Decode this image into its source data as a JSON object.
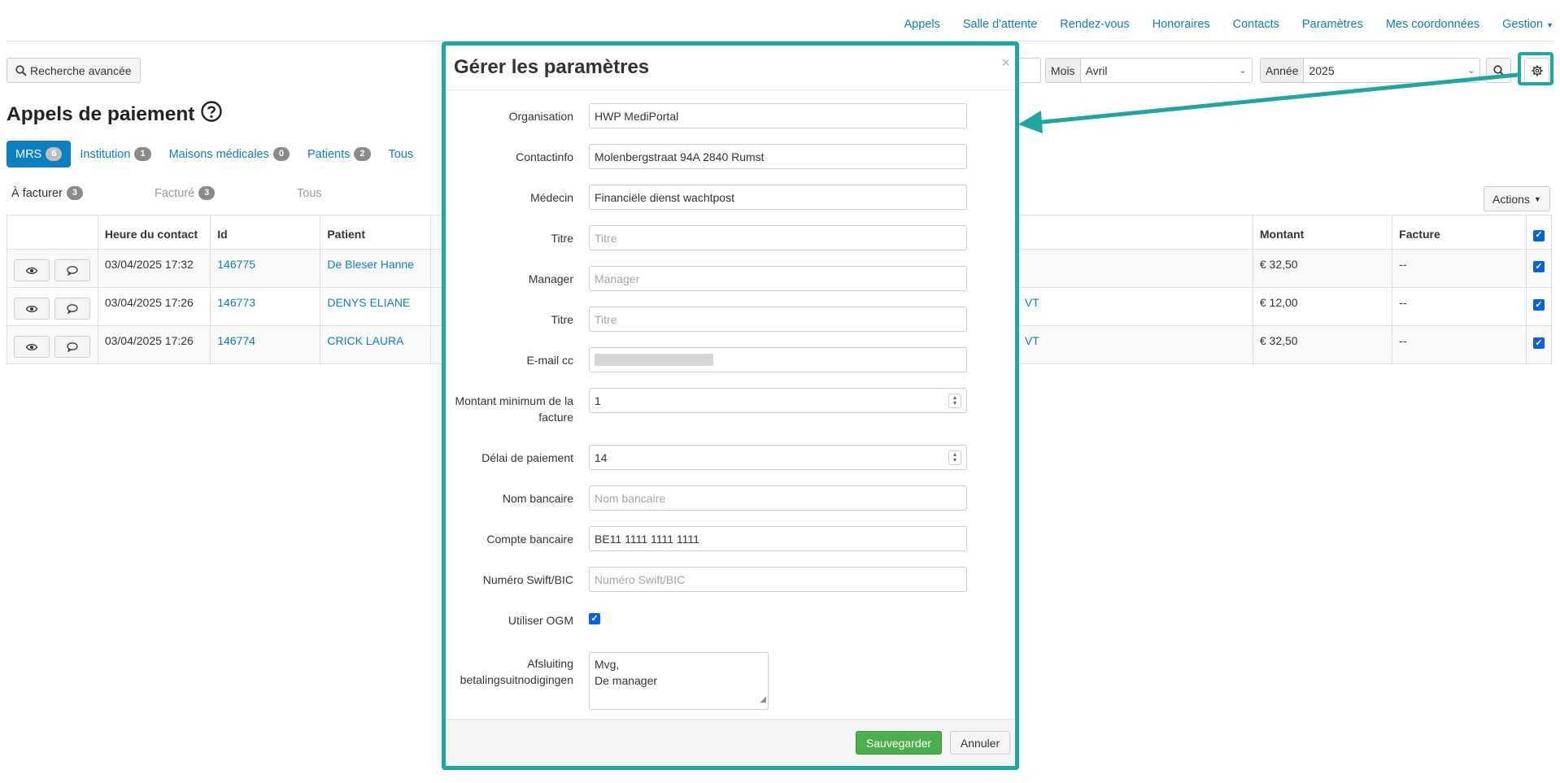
{
  "nav": {
    "items": [
      "Appels",
      "Salle d'attente",
      "Rendez-vous",
      "Honoraires",
      "Contacts",
      "Paramètres",
      "Mes coordonnées"
    ],
    "gestion": "Gestion"
  },
  "toolbar": {
    "advanced_search": "Recherche avancée",
    "month_label": "Mois",
    "month_value": "Avril",
    "year_label": "Année",
    "year_value": "2025"
  },
  "page": {
    "title": "Appels de paiement"
  },
  "tabs": [
    {
      "label": "MRS",
      "count": "6"
    },
    {
      "label": "Institution",
      "count": "1"
    },
    {
      "label": "Maisons médicales",
      "count": "0"
    },
    {
      "label": "Patients",
      "count": "2"
    },
    {
      "label": "Tous"
    }
  ],
  "subtabs": [
    {
      "label": "À facturer",
      "count": "3"
    },
    {
      "label": "Facturé",
      "count": "3"
    },
    {
      "label": "Tous"
    }
  ],
  "actions_label": "Actions",
  "table": {
    "headers": {
      "time": "Heure du contact",
      "id": "Id",
      "patient": "Patient",
      "amount": "Montant",
      "invoice": "Facture"
    },
    "rows": [
      {
        "time": "03/04/2025 17:32",
        "id": "146775",
        "patient": "De Bleser Hanne",
        "extra": "",
        "amount": "€ 32,50",
        "invoice": "--"
      },
      {
        "time": "03/04/2025 17:26",
        "id": "146773",
        "patient": "DENYS ELIANE",
        "extra": "VT",
        "amount": "€ 12,00",
        "invoice": "--"
      },
      {
        "time": "03/04/2025 17:26",
        "id": "146774",
        "patient": "CRICK LAURA",
        "extra": "VT",
        "amount": "€ 32,50",
        "invoice": "--"
      }
    ]
  },
  "modal": {
    "title": "Gérer les paramètres",
    "close": "×",
    "fields": {
      "organisation": {
        "label": "Organisation",
        "value": "HWP MediPortal"
      },
      "contactinfo": {
        "label": "Contactinfo",
        "value": "Molenbergstraat 94A 2840 Rumst"
      },
      "medecin": {
        "label": "Médecin",
        "value": "Financiële dienst wachtpost"
      },
      "titre1": {
        "label": "Titre",
        "placeholder": "Titre"
      },
      "manager": {
        "label": "Manager",
        "placeholder": "Manager"
      },
      "titre2": {
        "label": "Titre",
        "placeholder": "Titre"
      },
      "email_cc": {
        "label": "E-mail cc"
      },
      "min_amount": {
        "label": "Montant minimum de la facture",
        "value": "1"
      },
      "payment_delay": {
        "label": "Délai de paiement",
        "value": "14"
      },
      "bank_name": {
        "label": "Nom bancaire",
        "placeholder": "Nom bancaire"
      },
      "bank_account": {
        "label": "Compte bancaire",
        "value": "BE11 1111 1111 1111"
      },
      "swift": {
        "label": "Numéro Swift/BIC",
        "placeholder": "Numéro Swift/BIC"
      },
      "use_ogm": {
        "label": "Utiliser OGM",
        "checked": true
      },
      "closing": {
        "label": "Afsluiting betalingsuitnodigingen",
        "line1": "Mvg,",
        "line2": "De manager"
      }
    },
    "save_label": "Sauvegarder",
    "cancel_label": "Annuler"
  },
  "colors": {
    "link": "#0b7fc1",
    "highlight": "#1ea7a0",
    "save": "#4cae4c",
    "checkbox": "#0b63d9"
  }
}
